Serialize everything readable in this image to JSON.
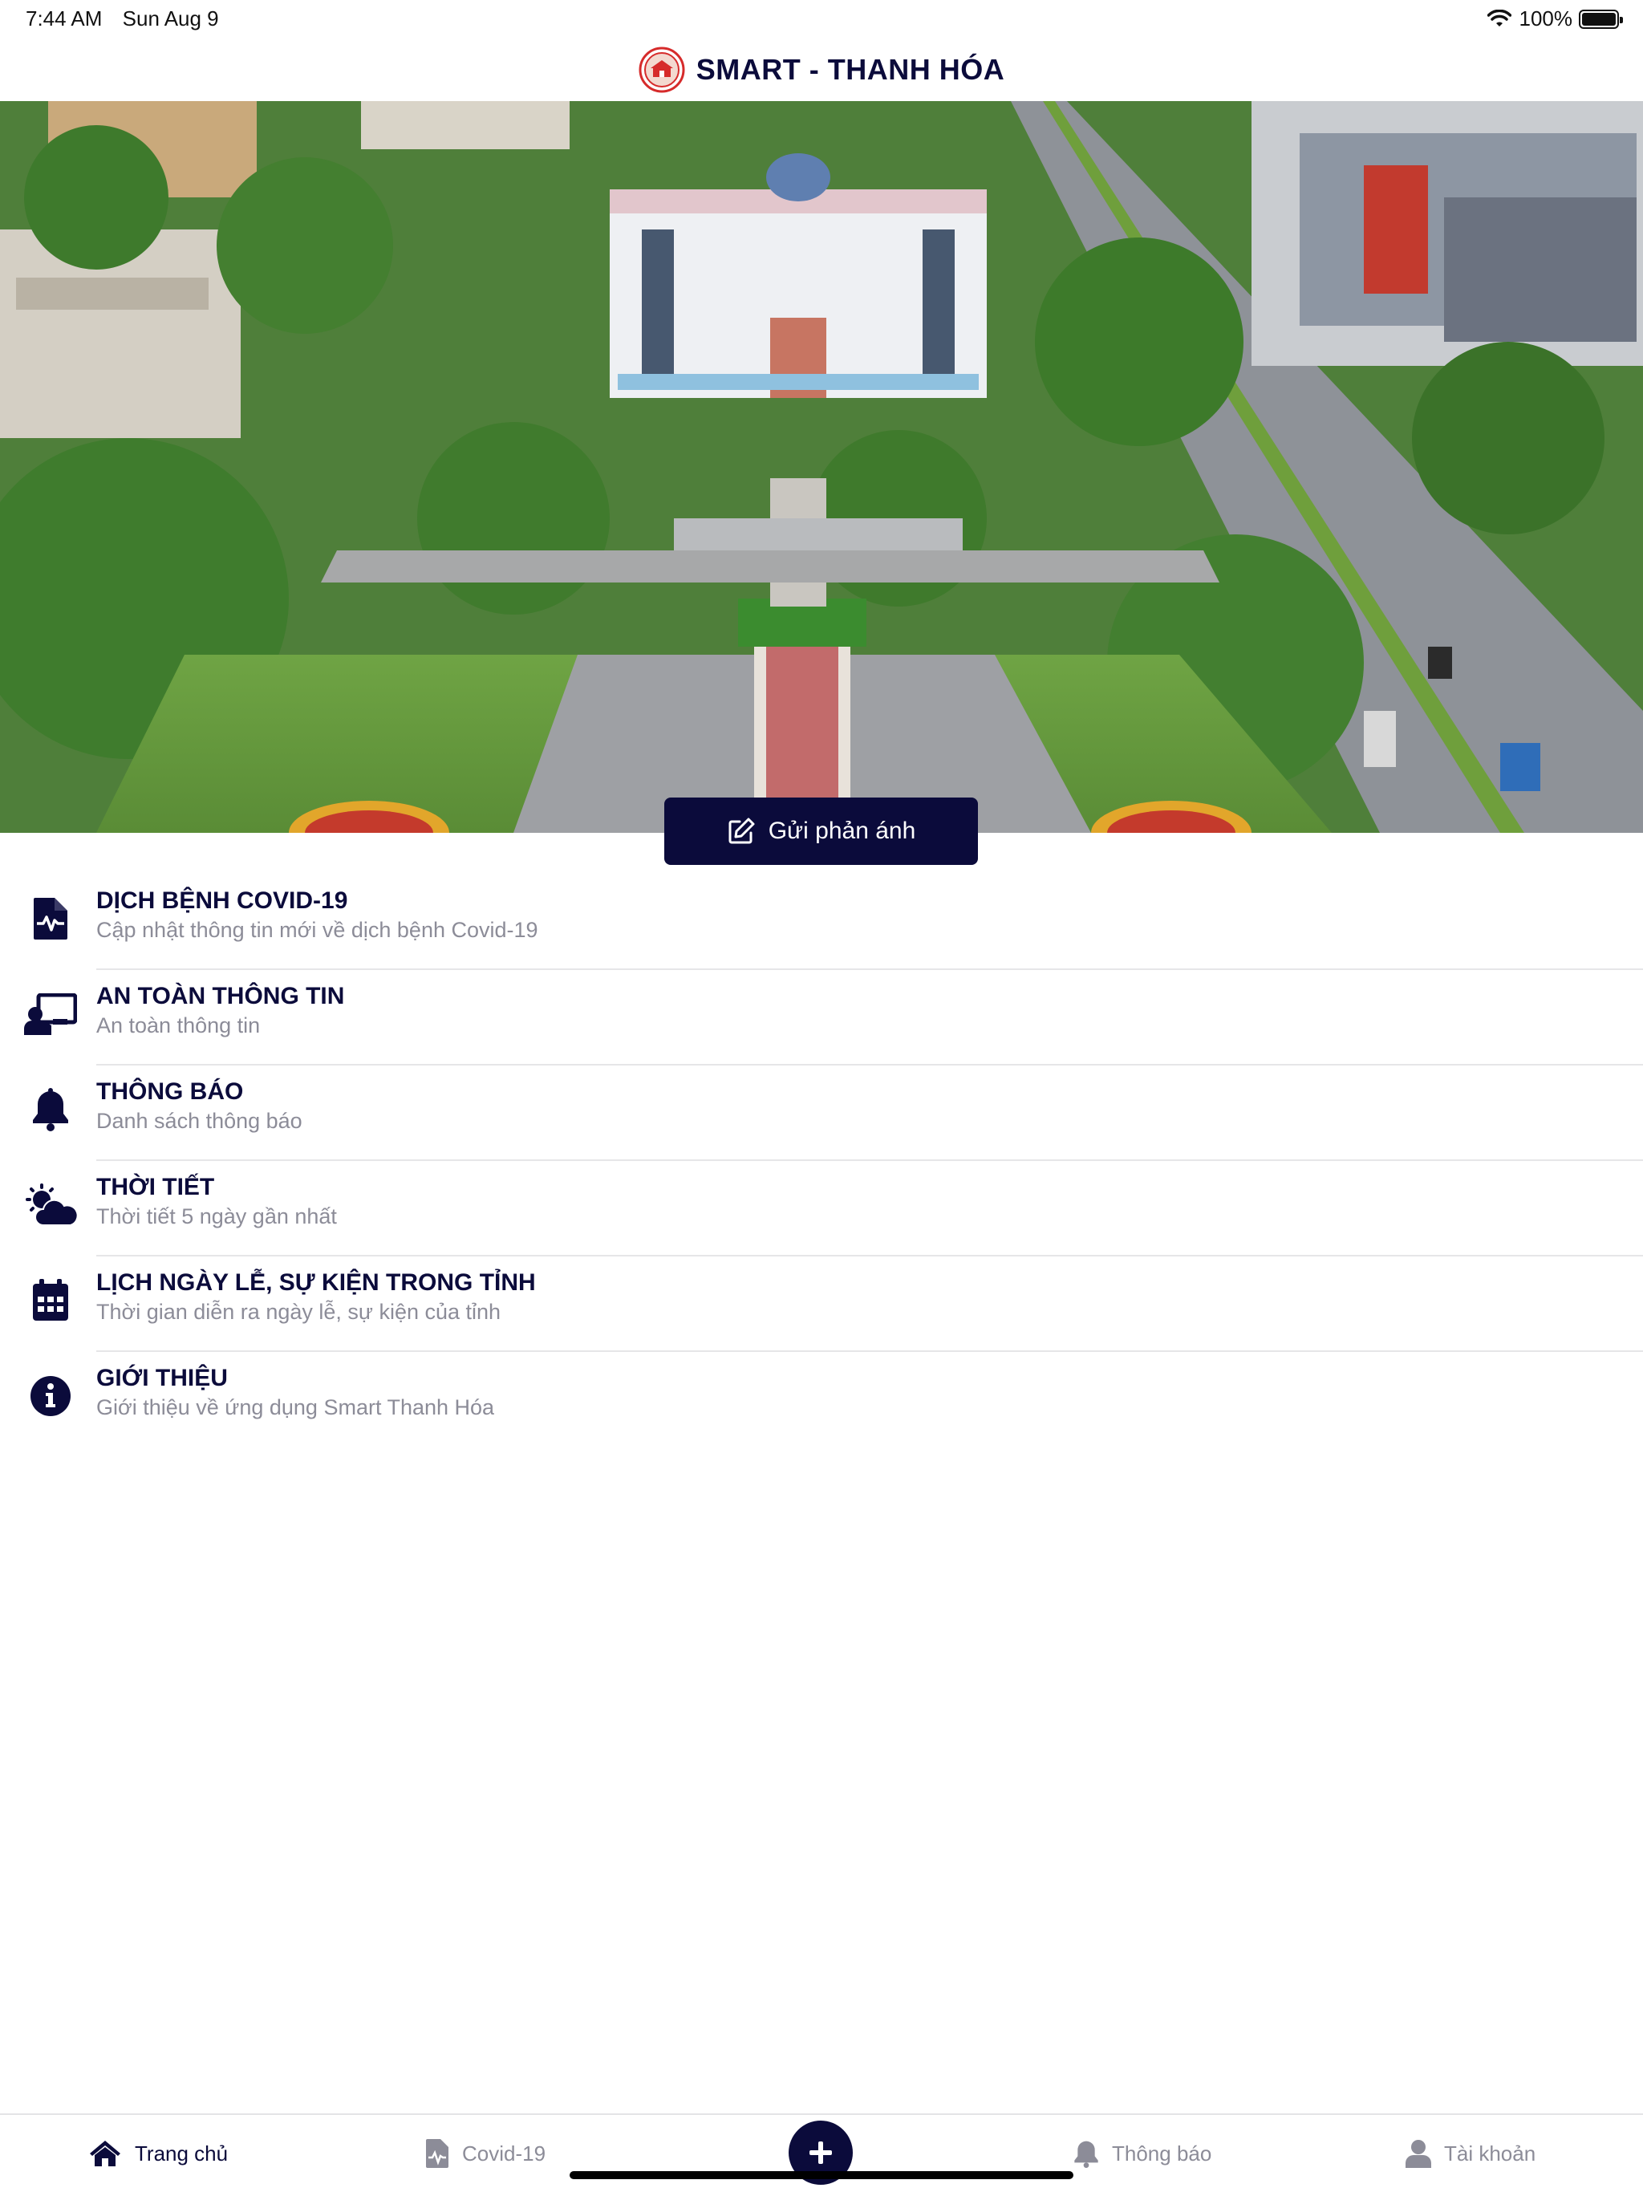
{
  "status_bar": {
    "time": "7:44 AM",
    "date": "Sun Aug 9",
    "battery_text": "100%",
    "battery_level": 1.0
  },
  "header": {
    "title": "SMART - THANH HÓA",
    "logo_icon": "thanh-hoa-emblem-icon"
  },
  "hero": {
    "image": "aerial-city-square-photo",
    "cta_label": "Gửi phản ánh",
    "cta_icon": "edit-icon"
  },
  "menu": {
    "items": [
      {
        "title": "DỊCH BỆNH COVID-19",
        "subtitle": "Cập nhật thông tin mới về dịch bệnh Covid-19",
        "icon": "medical-file-icon"
      },
      {
        "title": "AN TOÀN THÔNG TIN",
        "subtitle": "An toàn thông tin",
        "icon": "chalkboard-teacher-icon"
      },
      {
        "title": "THÔNG BÁO",
        "subtitle": "Danh sách thông báo",
        "icon": "bell-icon"
      },
      {
        "title": "THỜI TIẾT",
        "subtitle": "Thời tiết 5 ngày gần nhất",
        "icon": "cloud-sun-icon"
      },
      {
        "title": "LỊCH NGÀY LỄ, SỰ KIỆN TRONG TỈNH",
        "subtitle": "Thời gian diễn ra ngày lễ, sự kiện của tỉnh",
        "icon": "calendar-icon"
      },
      {
        "title": "GIỚI THIỆU",
        "subtitle": "Giới thiệu về ứng dụng Smart Thanh Hóa",
        "icon": "info-icon"
      }
    ]
  },
  "tabbar": {
    "tabs": [
      {
        "label": "Trang chủ",
        "icon": "home-icon",
        "active": true
      },
      {
        "label": "Covid-19",
        "icon": "medical-file-icon",
        "active": false
      },
      {
        "label": "Thông báo",
        "icon": "bell-icon",
        "active": false
      },
      {
        "label": "Tài khoản",
        "icon": "user-icon",
        "active": false
      }
    ],
    "fab_icon": "plus-icon"
  },
  "colors": {
    "primary": "#0b0b3b",
    "subtitle": "#8c8c98",
    "divider": "#e6e6e8"
  }
}
